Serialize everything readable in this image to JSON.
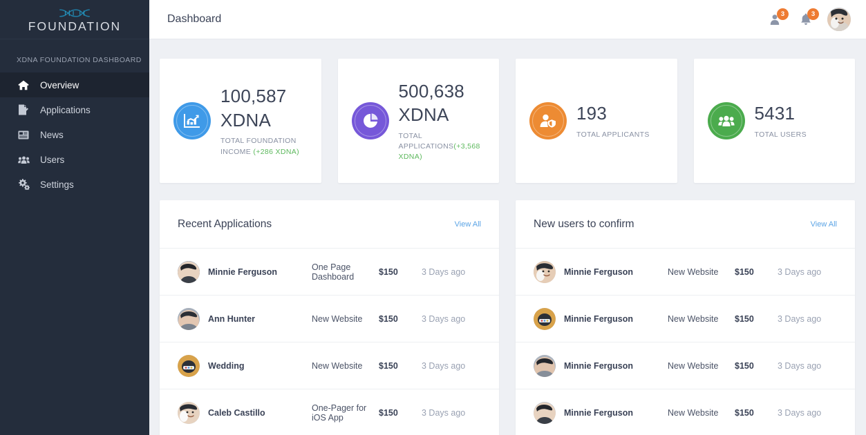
{
  "brand": {
    "name": "FOUNDATION",
    "mark_icon": "dna-helix-icon",
    "mark_color": "#1b6f96"
  },
  "sidebar": {
    "section_label": "XDNA FOUNDATION DASHBOARD",
    "bg_color": "#242d3c",
    "active_bg_color": "#1d2430",
    "items": [
      {
        "label": "Overview",
        "icon": "home-icon",
        "active": true
      },
      {
        "label": "Applications",
        "icon": "document-edit-icon",
        "active": false
      },
      {
        "label": "News",
        "icon": "newspaper-icon",
        "active": false
      },
      {
        "label": "Users",
        "icon": "users-group-icon",
        "active": false
      },
      {
        "label": "Settings",
        "icon": "gears-icon",
        "active": false
      }
    ]
  },
  "header": {
    "title": "Dashboard",
    "messages_icon": "user-messages-icon",
    "messages_count": "3",
    "notifications_icon": "bell-icon",
    "notifications_count": "3",
    "badge_color": "#ee7b32",
    "avatar_name": "avatar"
  },
  "stats": [
    {
      "value": "100,587 XDNA",
      "label": "TOTAL FOUNDATION INCOME ",
      "delta": "(+286 XDNA)",
      "icon": "line-chart-icon",
      "color": "#3f9ae8"
    },
    {
      "value": "500,638 XDNA",
      "label": "TOTAL APPLICATIONS",
      "delta": "(+3,568 XDNA)",
      "icon": "pie-chart-icon",
      "color": "#7658d9"
    },
    {
      "value": "193",
      "label": "TOTAL APPLICANTS",
      "delta": "",
      "icon": "user-shield-icon",
      "color": "#ed8b33"
    },
    {
      "value": "5431",
      "label": "TOTAL USERS",
      "delta": "",
      "icon": "users-group-icon",
      "color": "#4bab4d"
    }
  ],
  "panels": [
    {
      "title": "Recent Applications",
      "view_all": "View All",
      "rows": [
        {
          "name": "Minnie Ferguson",
          "project": "One Page Dashboard",
          "price": "$150",
          "time": "3 Days ago",
          "avatar_color": "#5a5f6b"
        },
        {
          "name": "Ann Hunter",
          "project": "New Website",
          "price": "$150",
          "time": "3 Days ago",
          "avatar_color": "#97a0ad"
        },
        {
          "name": "Wedding",
          "project": "New Website",
          "price": "$150",
          "time": "3 Days ago",
          "avatar_color": "#3f7fbf"
        },
        {
          "name": "Caleb Castillo",
          "project": "One-Pager for iOS App",
          "price": "$150",
          "time": "3 Days ago",
          "avatar_color": "#c9a08b"
        }
      ]
    },
    {
      "title": "New users to confirm",
      "view_all": "View All",
      "rows": [
        {
          "name": "Minnie Ferguson",
          "project": "New Website",
          "price": "$150",
          "time": "3 Days ago",
          "avatar_color": "#d8b59c"
        },
        {
          "name": "Minnie Ferguson",
          "project": "New Website",
          "price": "$150",
          "time": "3 Days ago",
          "avatar_color": "#3f7fbf"
        },
        {
          "name": "Minnie Ferguson",
          "project": "New Website",
          "price": "$150",
          "time": "3 Days ago",
          "avatar_color": "#8e97a5"
        },
        {
          "name": "Minnie Ferguson",
          "project": "New Website",
          "price": "$150",
          "time": "3 Days ago",
          "avatar_color": "#5a5f6b"
        }
      ]
    }
  ]
}
